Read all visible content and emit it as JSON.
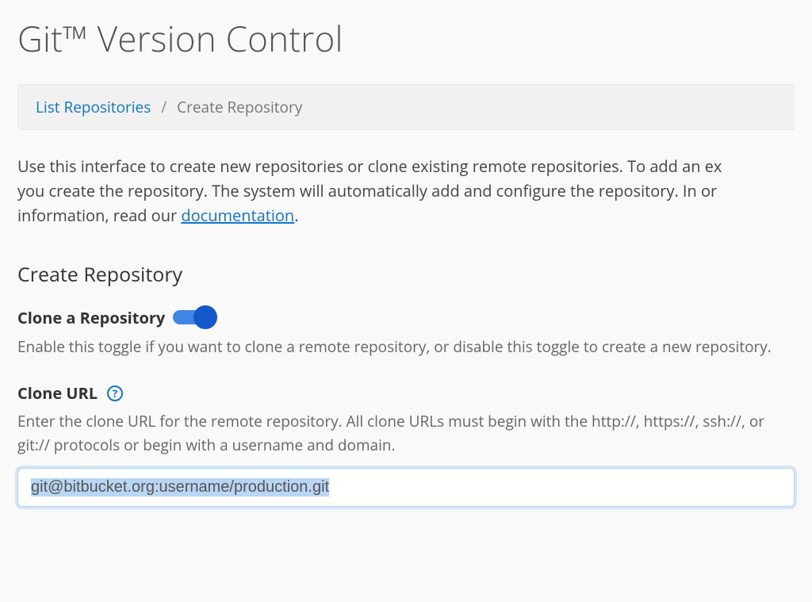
{
  "page": {
    "title": "Git™ Version Control"
  },
  "breadcrumb": {
    "link_label": "List Repositories",
    "separator": "/",
    "current": "Create Repository"
  },
  "intro": {
    "line1": "Use this interface to create new repositories or clone existing remote repositories. To add an ex",
    "line2": "you create the repository. The system will automatically add and configure the repository. In or",
    "line3_prefix": "information, read our ",
    "doc_link": "documentation",
    "line3_suffix": "."
  },
  "section": {
    "heading": "Create Repository"
  },
  "clone_toggle": {
    "label": "Clone a Repository",
    "on": true,
    "help": "Enable this toggle if you want to clone a remote repository, or disable this toggle to create a new repository."
  },
  "clone_url": {
    "label": "Clone URL",
    "help_icon": "?",
    "help": "Enter the clone URL for the remote repository. All clone URLs must begin with the http://, https://, ssh://, or git:// protocols or begin with a username and domain.",
    "value": "git@bitbucket.org:username/production.git"
  }
}
